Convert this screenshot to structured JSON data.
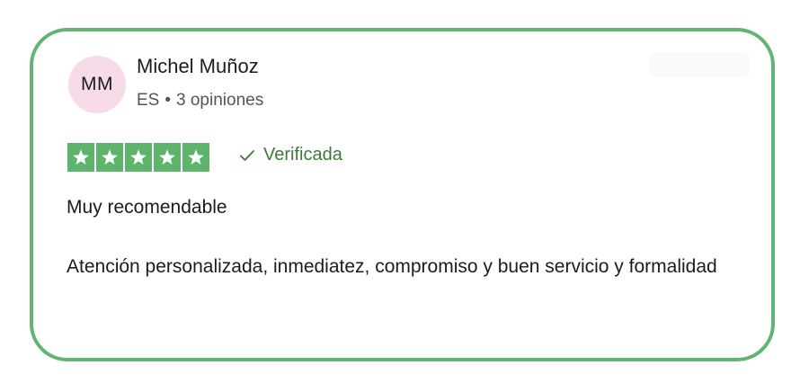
{
  "review": {
    "avatar_initials": "MM",
    "reviewer_name": "Michel Muñoz",
    "country": "ES",
    "review_count": "3 opiniones",
    "rating": 5,
    "rating_max": 5,
    "verified_label": "Verificada",
    "title": "Muy recomendable",
    "body": "Atención personalizada, inmediatez, compromiso y buen servicio y formalidad"
  },
  "icons": {
    "star": "star-icon",
    "verified": "check-icon"
  },
  "colors": {
    "card_border": "#63b474",
    "star_fill": "#5fb46d",
    "avatar_bg": "#f7dbe8",
    "verified_text": "#3e7a3a",
    "meta_text": "#555555"
  }
}
